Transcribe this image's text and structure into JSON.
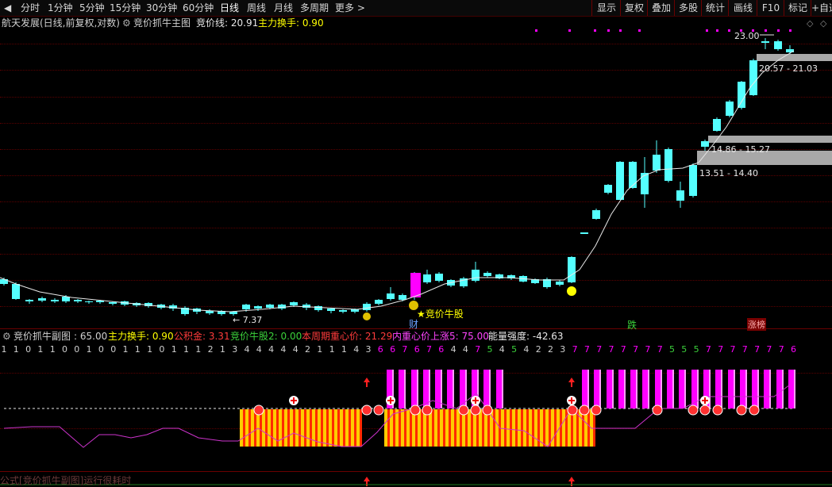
{
  "toolbar": {
    "left_items": [
      "分时",
      "1分钟",
      "5分钟",
      "15分钟",
      "30分钟",
      "60分钟",
      "日线",
      "周线",
      "月线",
      "多周期",
      "更多 >"
    ],
    "active": "日线",
    "right_items": [
      "显示",
      "复权",
      "叠加",
      "多股",
      "统计",
      "画线",
      "F10",
      "标记",
      "+自选"
    ]
  },
  "main_title": {
    "stock": "航天发展(日线,前复权,对数)",
    "indicator": "竞价抓牛主图",
    "line_label": "竞价线: 20.91",
    "turnover_label": "主力换手: 0.90"
  },
  "annotations": {
    "high_price": "23.00",
    "low_price": "7.37",
    "zone1": "20.57 - 21.03",
    "zone2": "14.86 - 15.27",
    "zone3": "13.51 - 14.40",
    "star_label": "竞价牛股",
    "cai": "财",
    "die": "跌",
    "zhangbang": "涨榜"
  },
  "sub_title": {
    "name": "竞价抓牛副图",
    "value": ": 65.00",
    "turnover": "主力换手: 0.90",
    "gongjijin": "公积金: 3.31",
    "niugu2": "竞价牛股2: 0.00",
    "center": "本周期重心价: 21.29",
    "inner": "内重心价上涨5: 75.00",
    "energy": "能量强度: -42.63"
  },
  "digit_row": [
    1,
    1,
    0,
    1,
    1,
    0,
    0,
    1,
    0,
    0,
    1,
    1,
    1,
    0,
    1,
    1,
    1,
    2,
    1,
    3,
    4,
    4,
    4,
    4,
    4,
    2,
    1,
    1,
    1,
    4,
    3,
    6,
    6,
    7,
    6,
    7,
    6,
    4,
    4,
    7,
    5,
    4,
    5,
    4,
    2,
    2,
    3,
    7,
    7,
    7,
    7,
    7,
    7,
    7,
    7,
    5,
    5,
    5,
    7,
    7,
    7,
    7,
    7,
    7,
    7,
    6
  ],
  "footer": "公式[竞价抓牛副图]运行很耗时",
  "colors": {
    "up": "#ff3b3b",
    "down": "#54ffff",
    "ma": "#e8e8e8",
    "magenta": "#ff00ff",
    "yellow": "#ffff00",
    "green": "#3bd23b"
  }
}
